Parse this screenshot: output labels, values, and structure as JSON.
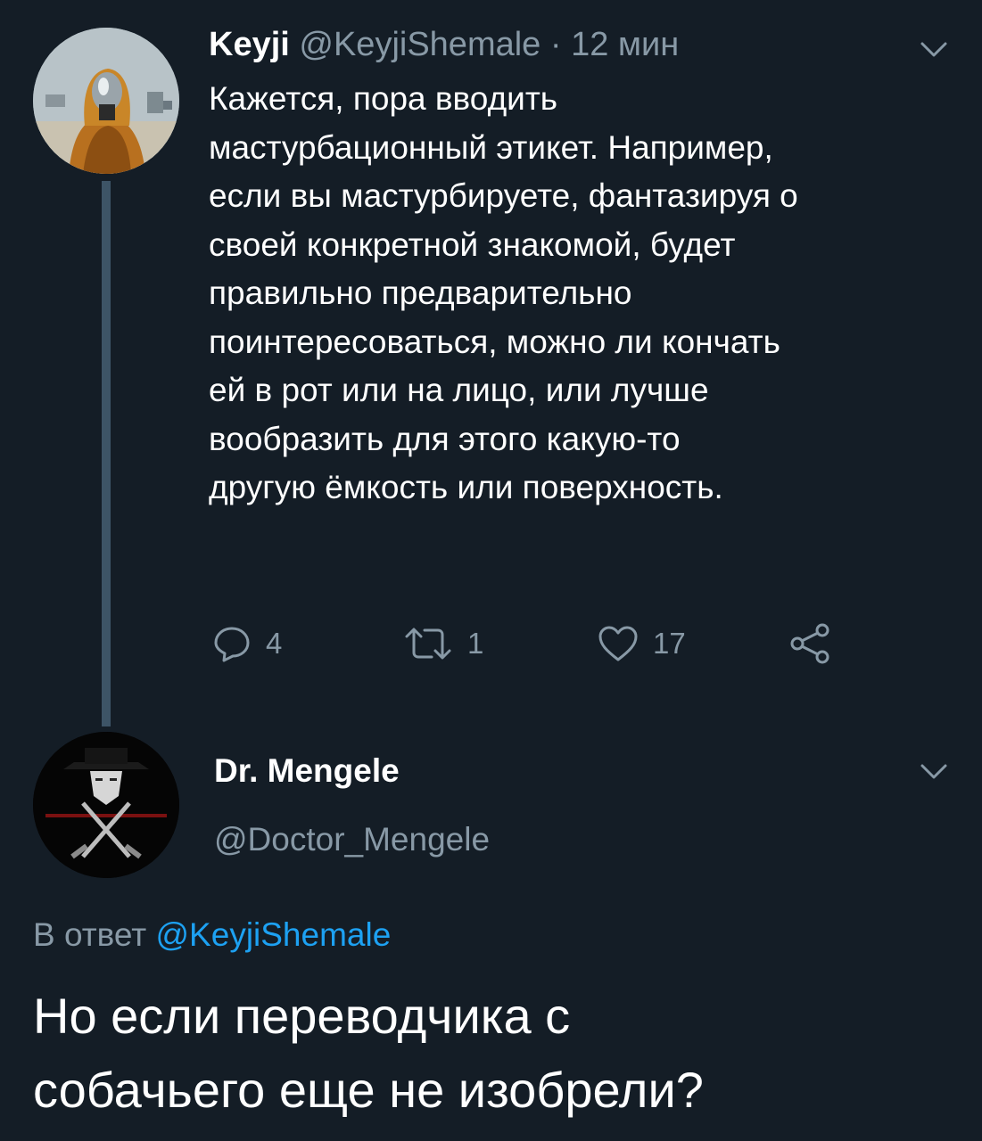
{
  "colors": {
    "background": "#141d26",
    "text_primary": "#ffffff",
    "text_muted": "#8899a6",
    "link": "#1da1f2",
    "thread_line": "#3d5466"
  },
  "tweet": {
    "author_name": "Keyji",
    "author_handle": "@KeyjiShemale",
    "separator": "·",
    "time": "12 мин",
    "menu_icon": "chevron-down-icon",
    "lines": [
      "Кажется, пора вводить",
      "мастурбационный этикет. Например,",
      "если вы мастурбируете, фантазируя о",
      "своей конкретной знакомой, будет",
      "правильно предварительно",
      "поинтересоваться, можно ли кончать",
      "ей в рот или на лицо, или лучше",
      "вообразить для этого какую-то",
      "другую ёмкость или поверхность."
    ],
    "actions": {
      "reply": {
        "icon": "reply-icon",
        "count": "4"
      },
      "retweet": {
        "icon": "retweet-icon",
        "count": "1"
      },
      "like": {
        "icon": "heart-icon",
        "count": "17"
      },
      "share": {
        "icon": "share-icon"
      }
    }
  },
  "reply": {
    "author_name": "Dr. Mengele",
    "author_handle": "@Doctor_Mengele",
    "menu_icon": "chevron-down-icon",
    "reply_to_prefix": "В ответ",
    "reply_to_handle": "@KeyjiShemale",
    "lines": [
      "Но если переводчика с",
      "собачьего еще не изобрели?"
    ]
  }
}
